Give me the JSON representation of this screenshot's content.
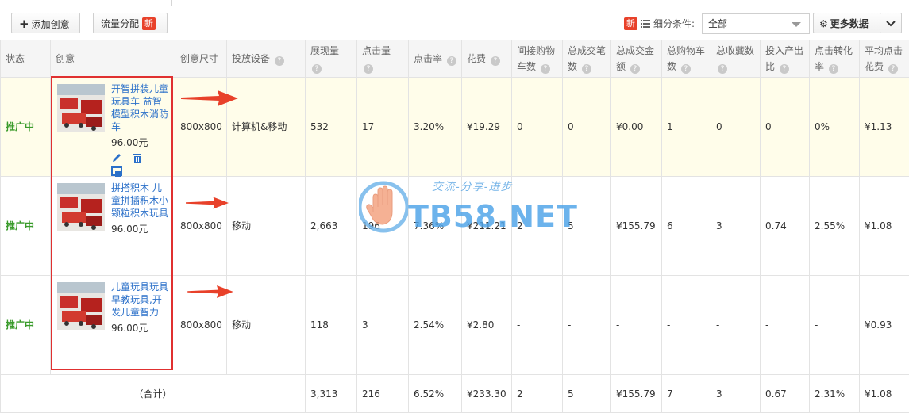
{
  "toolbar": {
    "add_label": "添加创意",
    "flow_label": "流量分配",
    "new_badge": "新",
    "filter_label": "细分条件:",
    "filter_value": "全部",
    "more_label": "更多数据"
  },
  "table": {
    "headers": [
      "状态",
      "创意",
      "创意尺寸",
      "投放设备",
      "展现量",
      "点击量",
      "点击率",
      "花费",
      "间接购物车数",
      "总成交笔数",
      "总成交金额",
      "总购物车数",
      "总收藏数",
      "投入产出比",
      "点击转化率",
      "平均点击花费"
    ],
    "rows": [
      {
        "status": "推广中",
        "title": "开智拼装儿童玩具车 益智模型积木消防车",
        "price": "96.00元",
        "size": "800x800",
        "device": "计算机&移动",
        "impressions": "532",
        "clicks": "17",
        "ctr": "3.20%",
        "cost": "¥19.29",
        "indirect_cart": "0",
        "total_orders": "0",
        "total_amount": "¥0.00",
        "total_cart": "1",
        "favorites": "0",
        "roi": "0",
        "cvr": "0%",
        "cpc": "¥1.13"
      },
      {
        "status": "推广中",
        "title": "拼搭积木 儿童拼插积木小颗粒积木玩具",
        "price": "96.00元",
        "size": "800x800",
        "device": "移动",
        "impressions": "2,663",
        "clicks": "196",
        "ctr": "7.36%",
        "cost": "¥211.21",
        "indirect_cart": "2",
        "total_orders": "5",
        "total_amount": "¥155.79",
        "total_cart": "6",
        "favorites": "3",
        "roi": "0.74",
        "cvr": "2.55%",
        "cpc": "¥1.08"
      },
      {
        "status": "推广中",
        "title": "儿童玩具玩具早教玩具,开发儿童智力",
        "price": "96.00元",
        "size": "800x800",
        "device": "移动",
        "impressions": "118",
        "clicks": "3",
        "ctr": "2.54%",
        "cost": "¥2.80",
        "indirect_cart": "-",
        "total_orders": "-",
        "total_amount": "-",
        "total_cart": "-",
        "favorites": "-",
        "roi": "-",
        "cvr": "-",
        "cpc": "¥0.93"
      }
    ],
    "total": {
      "label": "（合计）",
      "impressions": "3,313",
      "clicks": "216",
      "ctr": "6.52%",
      "cost": "¥233.30",
      "indirect_cart": "2",
      "total_orders": "5",
      "total_amount": "¥155.79",
      "total_cart": "7",
      "favorites": "3",
      "roi": "0.67",
      "cvr": "2.31%",
      "cpc": "¥1.08"
    }
  },
  "watermark": {
    "slogan": "交流-分享-进步",
    "text": "TB58.NET"
  },
  "colors": {
    "accent": "#2b70c9",
    "status": "#3a9b2b",
    "badge": "#e8412a",
    "highlight": "#e03030"
  }
}
